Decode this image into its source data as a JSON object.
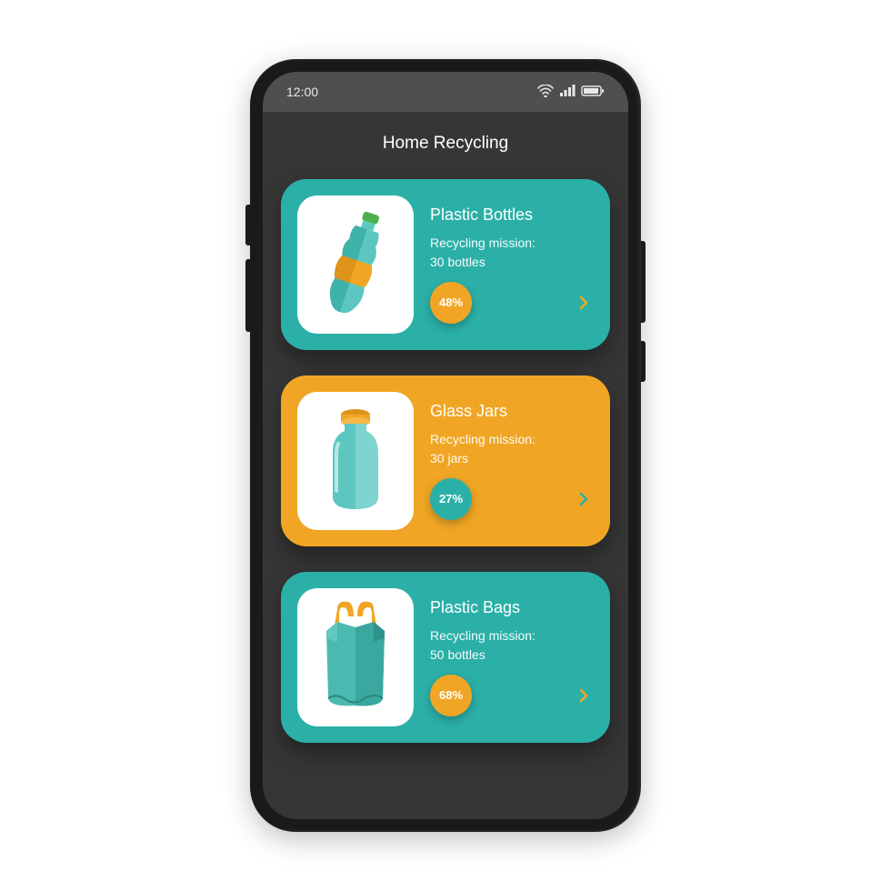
{
  "status": {
    "time": "12:00"
  },
  "page": {
    "title": "Home Recycling"
  },
  "cards": [
    {
      "variant": "teal",
      "icon": "bottle-icon",
      "title": "Plastic Bottles",
      "subtitle_line1": "Recycling mission:",
      "subtitle_line2": "30 bottles",
      "percent": "48%"
    },
    {
      "variant": "amber",
      "icon": "jar-icon",
      "title": "Glass Jars",
      "subtitle_line1": "Recycling mission:",
      "subtitle_line2": "30 jars",
      "percent": "27%"
    },
    {
      "variant": "teal",
      "icon": "bag-icon",
      "title": "Plastic Bags",
      "subtitle_line1": "Recycling mission:",
      "subtitle_line2": "50 bottles",
      "percent": "68%"
    }
  ]
}
